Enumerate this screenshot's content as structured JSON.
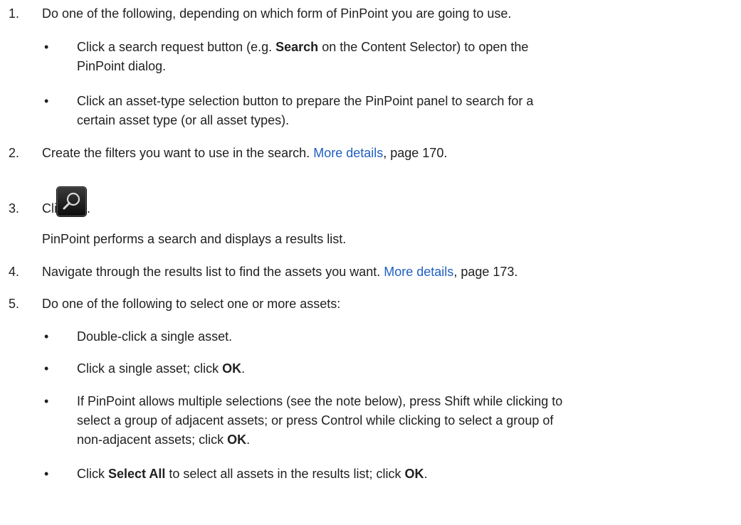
{
  "steps": [
    {
      "num": "1.",
      "text": "Do one of the following, depending on which form of PinPoint you are going to use."
    },
    {
      "num": "2.",
      "text_before": "Create the filters you want to use in the search. ",
      "link": "More details",
      "text_after": ", page 170."
    },
    {
      "num": "3.",
      "label": "Click",
      "suffix": ".",
      "icon": "search-magnifier-icon",
      "result": "PinPoint performs a search and displays a results list."
    },
    {
      "num": "4.",
      "text_before": "Navigate through the results list to find the assets you want. ",
      "link": "More details",
      "text_after": ", page 173."
    },
    {
      "num": "5.",
      "text": "Do one of the following to select one or more assets:"
    }
  ],
  "step1_bullets": [
    {
      "l1_a": "Click a search request button (e.g. ",
      "l1_b": "Search",
      "l1_c": " on the Content Selector) to open the",
      "l2": "PinPoint dialog."
    },
    {
      "l1": "Click an asset-type selection button to prepare the PinPoint panel to search for a",
      "l2": "certain asset type (or all asset types)."
    }
  ],
  "step5_bullets": [
    {
      "text": "Double-click a single asset."
    },
    {
      "a": "Click a single asset; click ",
      "b": "OK",
      "c": "."
    },
    {
      "l1": "If PinPoint allows multiple selections (see the note below), press Shift while clicking to",
      "l2": "select a group of adjacent assets; or press Control while clicking to select a group of",
      "l3_a": "non-adjacent assets; click ",
      "l3_b": "OK",
      "l3_c": "."
    },
    {
      "a": "Click ",
      "b": "Select All",
      "c": " to select all assets in the results list; click ",
      "d": "OK",
      "e": "."
    }
  ],
  "bullet_glyph": "•"
}
